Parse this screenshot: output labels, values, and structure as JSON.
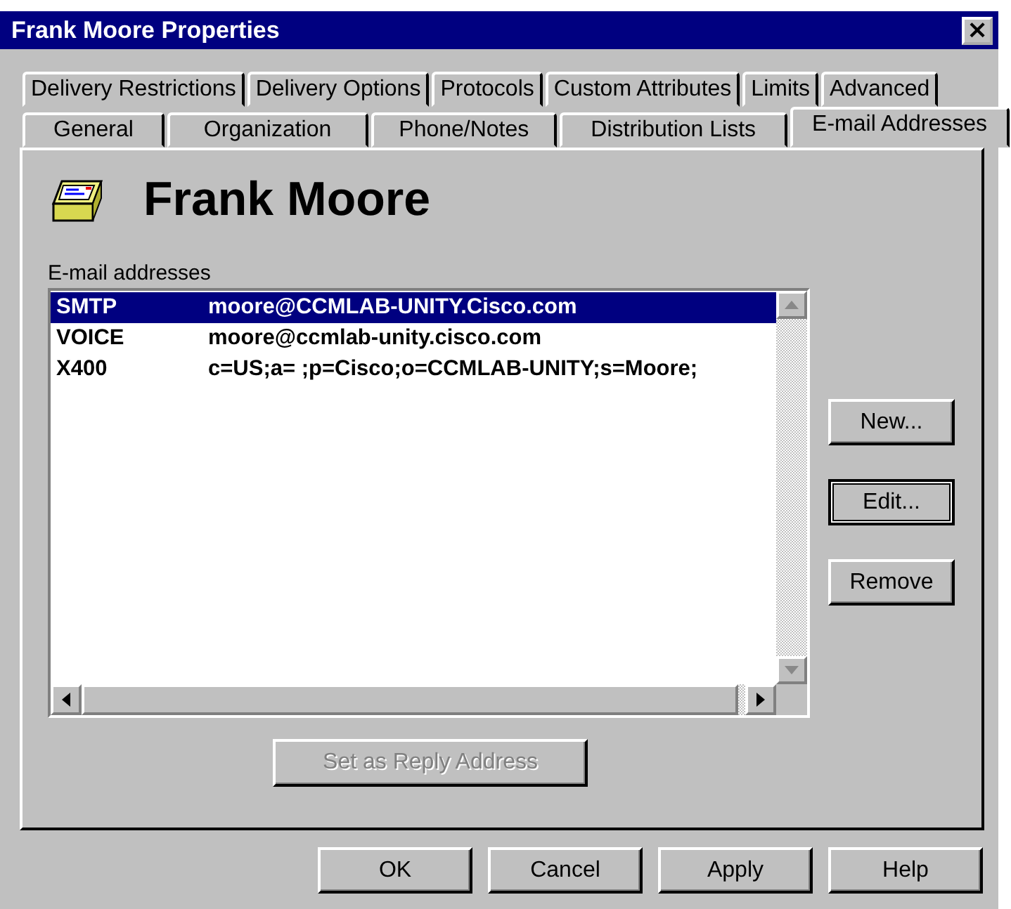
{
  "window": {
    "title": "Frank Moore Properties",
    "close": "×"
  },
  "tab_rows": [
    [
      {
        "label": "Delivery Restrictions",
        "selected": false
      },
      {
        "label": "Delivery Options",
        "selected": false
      },
      {
        "label": "Protocols",
        "selected": false
      },
      {
        "label": "Custom Attributes",
        "selected": false
      },
      {
        "label": "Limits",
        "selected": false
      },
      {
        "label": "Advanced",
        "selected": false
      }
    ],
    [
      {
        "label": "General",
        "selected": false
      },
      {
        "label": "Organization",
        "selected": false
      },
      {
        "label": "Phone/Notes",
        "selected": false
      },
      {
        "label": "Distribution Lists",
        "selected": false
      },
      {
        "label": "E-mail Addresses",
        "selected": true
      }
    ]
  ],
  "header": {
    "name": "Frank Moore"
  },
  "addresses": {
    "label": "E-mail addresses",
    "items": [
      {
        "type": "SMTP",
        "address": "moore@CCMLAB-UNITY.Cisco.com",
        "selected": true
      },
      {
        "type": "VOICE",
        "address": "moore@ccmlab-unity.cisco.com",
        "selected": false
      },
      {
        "type": "X400",
        "address": "c=US;a= ;p=Cisco;o=CCMLAB-UNITY;s=Moore;",
        "selected": false
      }
    ]
  },
  "side_buttons": [
    {
      "label": "New...",
      "focused": false
    },
    {
      "label": "Edit...",
      "focused": true
    },
    {
      "label": "Remove",
      "focused": false
    }
  ],
  "reply_button": {
    "label": "Set as Reply Address",
    "disabled": true
  },
  "dialog_buttons": [
    {
      "label": "OK"
    },
    {
      "label": "Cancel"
    },
    {
      "label": "Apply"
    },
    {
      "label": "Help"
    }
  ]
}
